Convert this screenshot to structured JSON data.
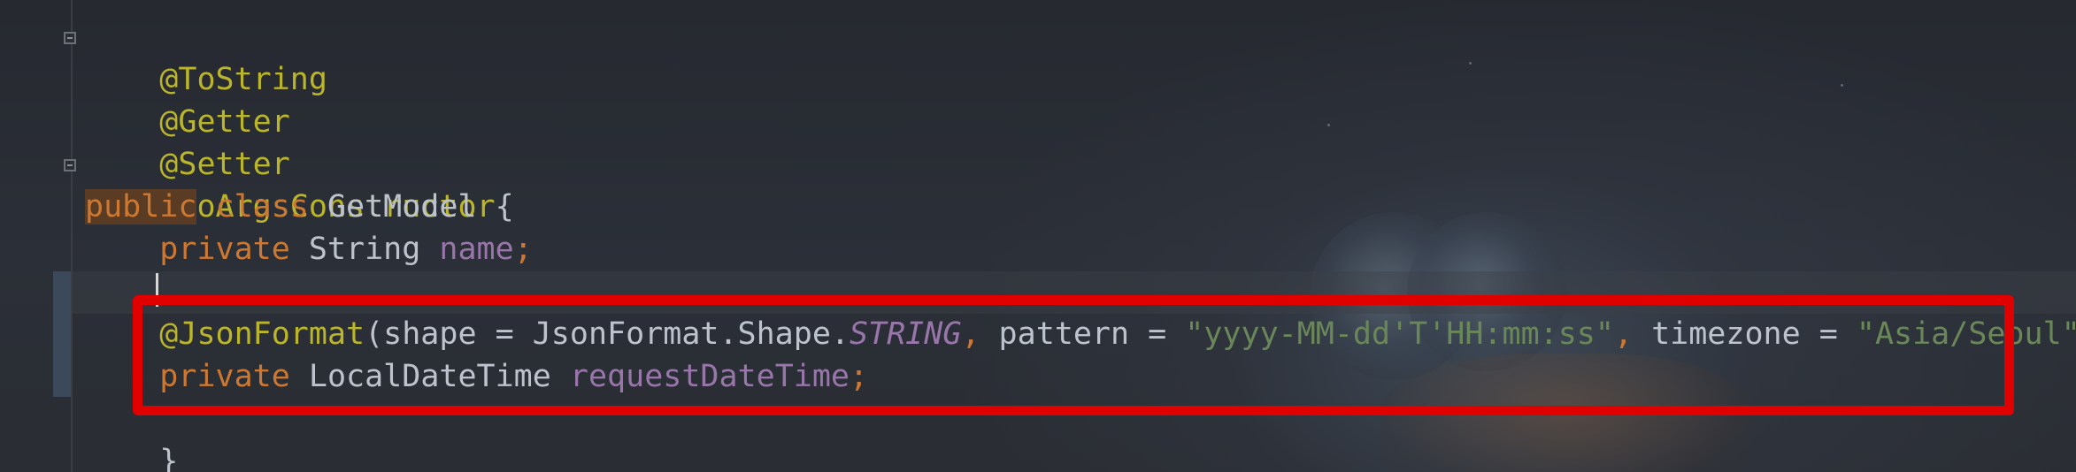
{
  "code": {
    "line1": {
      "text": "@ToString"
    },
    "line2": {
      "text": "@Getter"
    },
    "line3": {
      "text": "@Setter"
    },
    "line4": {
      "text": "@NoArgsConstructor"
    },
    "line5": {
      "kw1": "public",
      "kw2": "class",
      "rest": "GetModel {"
    },
    "line6": {
      "kw": "private",
      "type": "String",
      "field": "name",
      "semi": ";"
    },
    "line8": {
      "ann": "@JsonFormat",
      "p1": "(shape = JsonFormat.Shape.",
      "const": "STRING",
      "comma1": ",",
      "p2": " pattern = ",
      "str1": "\"yyyy-MM-dd'T'HH:mm:ss\"",
      "comma2": ",",
      "p3": " timezone = ",
      "str2": "\"Asia/Seoul\"",
      "close": ")"
    },
    "line9": {
      "kw": "private",
      "type": "LocalDateTime",
      "field": "requestDateTime",
      "semi": ";"
    },
    "line10": {
      "text": "}"
    }
  },
  "colors": {
    "annotation": "#bbb529",
    "keyword": "#cc7832",
    "field": "#9876aa",
    "string": "#6a8759",
    "text": "#bdc3cc",
    "highlight_box": "#e00000"
  }
}
